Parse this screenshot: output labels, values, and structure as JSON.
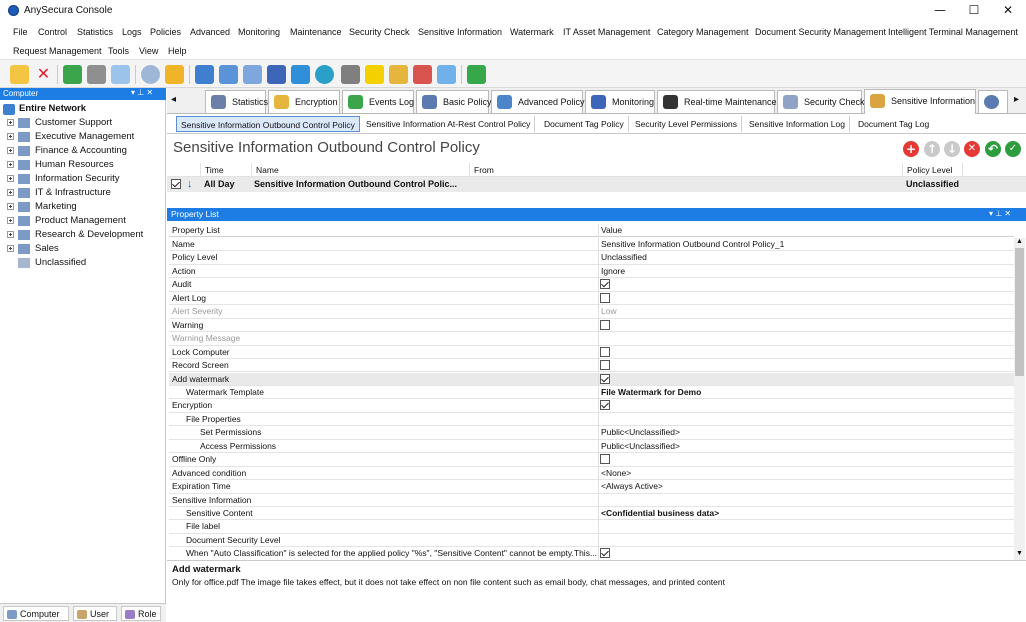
{
  "window": {
    "title": "AnySecura Console",
    "minimize": "—",
    "maximize": "☐",
    "close": "✕"
  },
  "menu": [
    "File",
    "Control",
    "Statistics",
    "Logs",
    "Policies",
    "Advanced",
    "Monitoring",
    "Maintenance",
    "Security Check",
    "Sensitive Information",
    "Watermark",
    "IT Asset Management",
    "Category Management",
    "Document Security Management",
    "Intelligent Terminal Management",
    "Request Management",
    "Tools",
    "View",
    "Help"
  ],
  "left_panel": {
    "header": "Computer",
    "root": "Entire Network",
    "groups": [
      "Customer Support",
      "Executive Management",
      "Finance & Accounting",
      "Human Resources",
      "Information Security",
      "IT & Infrastructure",
      "Marketing",
      "Product Management",
      "Research & Development",
      "Sales",
      "Unclassified"
    ],
    "bottom_tabs": [
      "Computer",
      "User",
      "Role"
    ]
  },
  "main_tabs": [
    "Statistics",
    "Encryption",
    "Events Log",
    "Basic Policy",
    "Advanced Policy",
    "Monitoring",
    "Real-time Maintenance",
    "Security Check",
    "Sensitive Information"
  ],
  "sub_tabs": [
    "Sensitive Information Outbound Control Policy",
    "Sensitive Information At-Rest Control Policy",
    "Document Tag Policy",
    "Security Level Permissions",
    "Sensitive Information Log",
    "Document Tag Log"
  ],
  "policy_title": "Sensitive Information Outbound Control Policy",
  "policy_grid": {
    "headers": [
      "Time",
      "Name",
      "From",
      "Policy Level"
    ],
    "row": {
      "time": "All Day",
      "name": "Sensitive Information Outbound Control Polic...",
      "from": "",
      "level": "Unclassified"
    }
  },
  "property_list": {
    "header": "Property List",
    "col_name": "Property List",
    "col_value": "Value",
    "rows": [
      {
        "name": "Name",
        "value": "Sensitive Information Outbound Control Policy_1",
        "type": "text",
        "indent": 0
      },
      {
        "name": "Policy Level",
        "value": "Unclassified",
        "type": "text",
        "indent": 0
      },
      {
        "name": "Action",
        "value": "Ignore",
        "type": "text",
        "indent": 0
      },
      {
        "name": "Audit",
        "checked": true,
        "type": "check",
        "indent": 0
      },
      {
        "name": "Alert Log",
        "checked": false,
        "type": "check",
        "indent": 0
      },
      {
        "name": "Alert Severity",
        "value": "Low",
        "type": "text",
        "indent": 0,
        "disabled": true
      },
      {
        "name": "Warning",
        "checked": false,
        "type": "check",
        "indent": 0
      },
      {
        "name": "Warning Message",
        "value": "",
        "type": "text",
        "indent": 0,
        "disabled": true
      },
      {
        "name": "Lock Computer",
        "checked": false,
        "type": "check",
        "indent": 0
      },
      {
        "name": "Record Screen",
        "checked": false,
        "type": "check",
        "indent": 0
      },
      {
        "name": "Add watermark",
        "checked": true,
        "type": "check",
        "indent": 0,
        "selected": true
      },
      {
        "name": "Watermark Template",
        "value": "File Watermark for Demo",
        "type": "text",
        "indent": 1,
        "bold": true
      },
      {
        "name": "Encryption",
        "checked": true,
        "type": "check",
        "indent": 0
      },
      {
        "name": "File Properties",
        "value": "",
        "type": "text",
        "indent": 1
      },
      {
        "name": "Set Permissions",
        "value": "Public<Unclassified>",
        "type": "text",
        "indent": 2
      },
      {
        "name": "Access Permissions",
        "value": "Public<Unclassified>",
        "type": "text",
        "indent": 2
      },
      {
        "name": "Offline Only",
        "checked": false,
        "type": "check",
        "indent": 0
      },
      {
        "name": "Advanced condition",
        "value": "<None>",
        "type": "text",
        "indent": 0
      },
      {
        "name": "Expiration Time",
        "value": "<Always Active>",
        "type": "text",
        "indent": 0
      },
      {
        "name": "Sensitive Information",
        "value": "",
        "type": "text",
        "indent": 0
      },
      {
        "name": "Sensitive Content",
        "value": "<Confidential business data>",
        "type": "text",
        "indent": 1,
        "bold": true
      },
      {
        "name": "File label",
        "value": "",
        "type": "text",
        "indent": 1
      },
      {
        "name": "Document Security Level",
        "value": "",
        "type": "text",
        "indent": 1
      },
      {
        "name": "When \"Auto Classification\" is selected for the applied policy \"%s\", \"Sensitive Content\" cannot be empty.This...",
        "checked": true,
        "type": "check",
        "indent": 1
      }
    ]
  },
  "description": {
    "title": "Add watermark",
    "text": "Only for office.pdf The image file takes effect, but it does not take effect on non file content such as email body, chat messages, and printed content"
  }
}
